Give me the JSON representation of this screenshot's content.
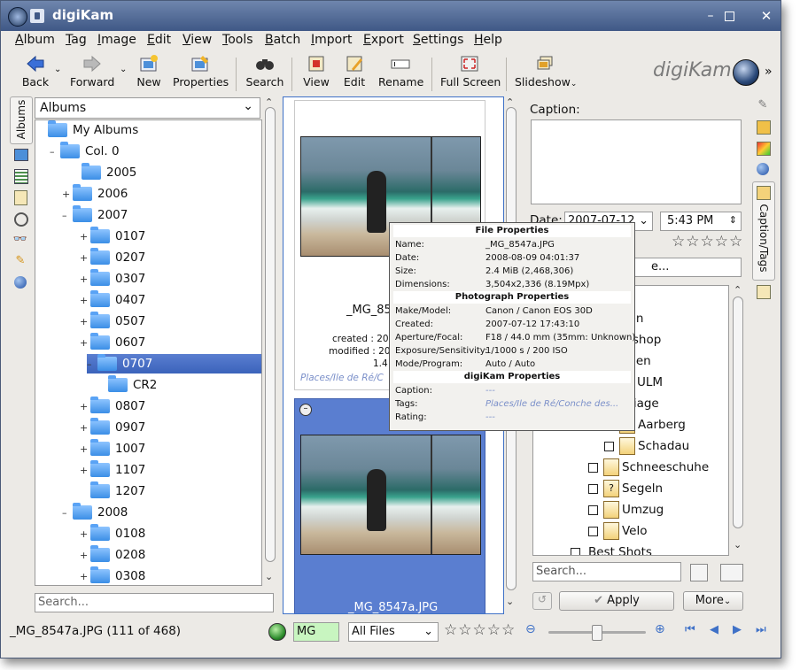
{
  "window": {
    "title": "digiKam"
  },
  "menu": [
    "Album",
    "Tag",
    "Image",
    "Edit",
    "View",
    "Tools",
    "Batch",
    "Import",
    "Export",
    "Settings",
    "Help"
  ],
  "toolbar": {
    "back": "Back",
    "forward": "Forward",
    "new": "New",
    "properties": "Properties",
    "search": "Search",
    "view": "View",
    "edit": "Edit",
    "rename": "Rename",
    "fullscreen": "Full Screen",
    "slideshow": "Slideshow",
    "logo": "digiKam"
  },
  "left_sidebar": {
    "tab_label": "Albums"
  },
  "albums": {
    "dropdown": "Albums",
    "search_placeholder": "Search...",
    "tree": [
      {
        "label": "My Albums"
      },
      {
        "label": "Col. 0"
      },
      {
        "label": "2005"
      },
      {
        "label": "2006"
      },
      {
        "label": "2007"
      },
      {
        "label": "0107"
      },
      {
        "label": "0207"
      },
      {
        "label": "0307"
      },
      {
        "label": "0407"
      },
      {
        "label": "0507"
      },
      {
        "label": "0607"
      },
      {
        "label": "0707"
      },
      {
        "label": "CR2"
      },
      {
        "label": "0807"
      },
      {
        "label": "0907"
      },
      {
        "label": "1007"
      },
      {
        "label": "1107"
      },
      {
        "label": "1207"
      },
      {
        "label": "2008"
      },
      {
        "label": "0108"
      },
      {
        "label": "0208"
      },
      {
        "label": "0308"
      }
    ]
  },
  "thumbs": {
    "item1": {
      "name": "_MG_85",
      "created": "created : 200",
      "modified": "modified : 200",
      "size": "1.4",
      "tags": "Places/Ile de Ré/C"
    },
    "item2": {
      "name": "_MG_8547a.JPG"
    }
  },
  "tooltip": {
    "file_header": "File Properties",
    "photo_header": "Photograph Properties",
    "digikam_header": "digiKam Properties",
    "rows_file": [
      {
        "k": "Name:",
        "v": "_MG_8547a.JPG"
      },
      {
        "k": "Date:",
        "v": "2008-08-09 04:01:37"
      },
      {
        "k": "Size:",
        "v": "2.4 MiB (2,468,306)"
      },
      {
        "k": "Dimensions:",
        "v": "3,504x2,336 (8.19Mpx)"
      }
    ],
    "rows_photo": [
      {
        "k": "Make/Model:",
        "v": "Canon / Canon EOS 30D"
      },
      {
        "k": "Created:",
        "v": "2007-07-12 17:43:10"
      },
      {
        "k": "Aperture/Focal:",
        "v": "F18 / 44.0 mm (35mm: Unknown)"
      },
      {
        "k": "Exposure/Sensitivity:",
        "v": "1/1000 s / 200 ISO"
      },
      {
        "k": "Mode/Program:",
        "v": "Auto / Auto"
      }
    ],
    "rows_digikam": [
      {
        "k": "Caption:",
        "v": "---"
      },
      {
        "k": "Tags:",
        "v": "Places/Ile de Ré/Conche des..."
      },
      {
        "k": "Rating:",
        "v": "---"
      }
    ]
  },
  "right_panel": {
    "caption_label": "Caption:",
    "date_label": "Date:",
    "date_value": "2007-07-12",
    "time_value": "5:43 PM",
    "tag_search_value": "e...",
    "tags": [
      {
        "label": "hen"
      },
      {
        "label": "d shop"
      },
      {
        "label": "egen"
      },
      {
        "label": "ULM"
      },
      {
        "label": "ariage"
      },
      {
        "label": "Aarberg"
      },
      {
        "label": "Schadau"
      },
      {
        "label": "Schneeschuhe"
      },
      {
        "label": "Segeln"
      },
      {
        "label": "Umzug"
      },
      {
        "label": "Velo"
      },
      {
        "label": "Best Shots"
      }
    ],
    "search_placeholder": "Search...",
    "apply": "Apply",
    "more": "More"
  },
  "right_sidebar": {
    "tab_label": "Caption/Tags"
  },
  "statusbar": {
    "info": "_MG_8547a.JPG (111 of 468)",
    "filter_text": "MG",
    "file_filter": "All Files",
    "zoom_fraction": 0.5
  }
}
